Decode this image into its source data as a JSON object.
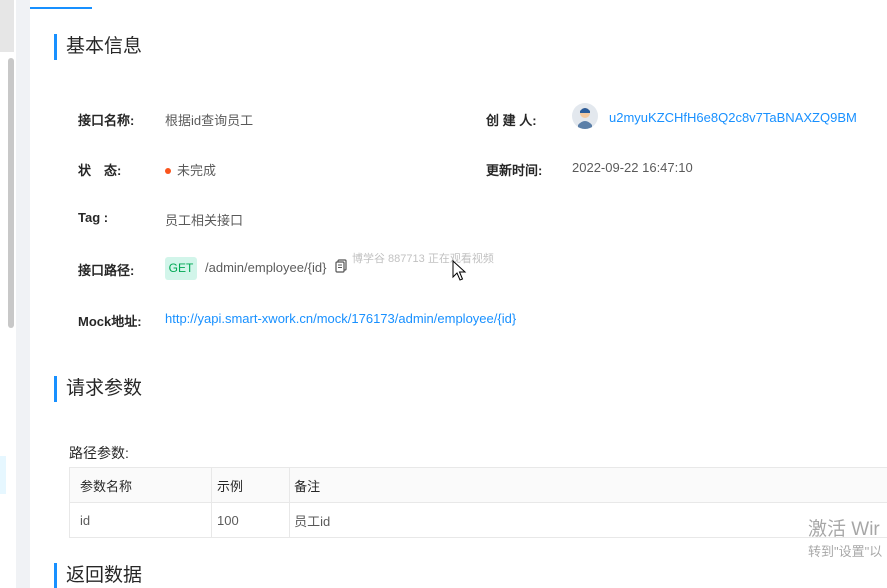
{
  "sections": {
    "basic_info": "基本信息",
    "request_params": "请求参数",
    "return_data": "返回数据"
  },
  "basic": {
    "name_label": "接口名称:",
    "name_value": "根据id查询员工",
    "creator_label": "创 建 人:",
    "creator_value": "u2myuKZCHfH6e8Q2c8v7TaBNAXZQ9BM",
    "status_label": "状　态:",
    "status_value": "未完成",
    "status_color": "#fa541c",
    "updated_label": "更新时间:",
    "updated_value": "2022-09-22 16:47:10",
    "tag_label": "Tag :",
    "tag_value": "员工相关接口",
    "path_label": "接口路径:",
    "method": "GET",
    "path_value": "/admin/employee/{id}",
    "mock_label": "Mock地址:",
    "mock_value": "http://yapi.smart-xwork.cn/mock/176173/admin/employee/{id}"
  },
  "watermark": "博学谷 887713 正在观看视频",
  "params": {
    "path_params_label": "路径参数:",
    "headers": [
      "参数名称",
      "示例",
      "备注"
    ],
    "rows": [
      [
        "id",
        "100",
        "员工id"
      ]
    ]
  },
  "windows_activation": {
    "title": "激活 Wir",
    "subtitle": "转到\"设置\"以"
  },
  "icons": {
    "copy": "copy-icon",
    "avatar": "user-avatar-icon",
    "cursor": "mouse-pointer-icon"
  },
  "colors": {
    "accent": "#1890ff",
    "get_badge_bg": "#d2f5ea",
    "get_badge_text": "#00a854"
  }
}
